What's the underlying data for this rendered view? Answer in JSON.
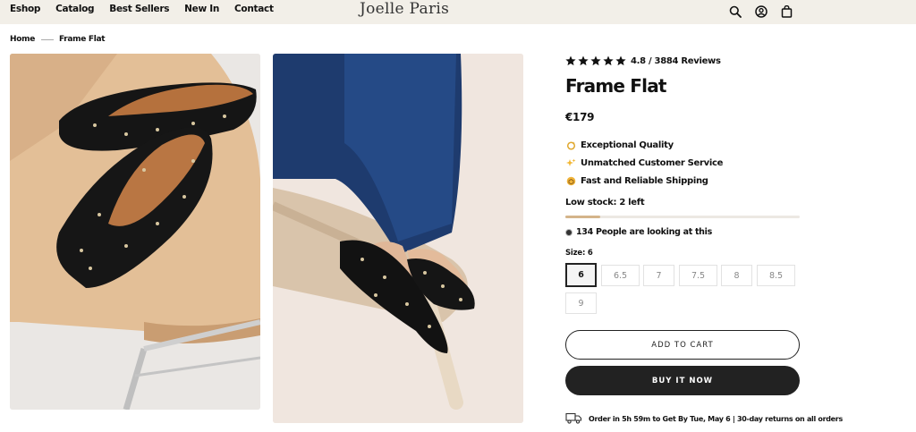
{
  "nav": {
    "links": [
      "Eshop",
      "Catalog",
      "Best Sellers",
      "New In",
      "Contact"
    ],
    "brand": "Joelle Paris",
    "icons": [
      "search-icon",
      "account-icon",
      "cart-icon"
    ]
  },
  "breadcrumb": {
    "home": "Home",
    "current": "Frame Flat"
  },
  "product": {
    "rating_stars": 5,
    "rating_text": "4.8 / 3884 Reviews",
    "title": "Frame Flat",
    "price": "€179",
    "features": [
      {
        "icon": "sparkle-ring-icon",
        "text": "Exceptional Quality"
      },
      {
        "icon": "sparkles-icon",
        "text": "Unmatched Customer Service"
      },
      {
        "icon": "package-icon",
        "text": "Fast and Reliable Shipping"
      }
    ],
    "stock_text": "Low stock: 2 left",
    "stock_fraction": 0.15,
    "looking_text": "134 People are looking at this",
    "size_label": "Size: 6",
    "sizes": [
      "6",
      "6.5",
      "7",
      "7.5",
      "8",
      "8.5",
      "9"
    ],
    "selected_size": "6",
    "add_to_cart": "ADD TO CART",
    "buy_now": "BUY IT NOW",
    "delivery_text": "Order in 5h 59m to Get By Tue, May 6 | 30-day returns on all orders"
  },
  "colors": {
    "topbar": "#f2efe8",
    "accent": "#222222",
    "stock_fill": "#d4b48a"
  }
}
